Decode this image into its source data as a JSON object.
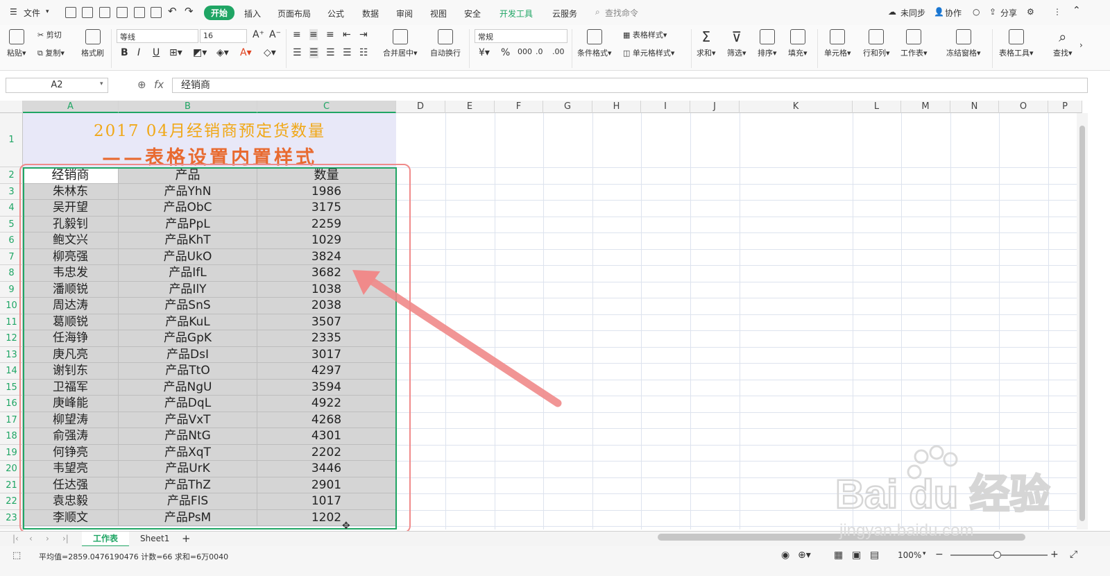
{
  "menubar": {
    "file": "文件",
    "tabs": [
      "开始",
      "插入",
      "页面布局",
      "公式",
      "数据",
      "审阅",
      "视图",
      "安全",
      "开发工具",
      "云服务"
    ],
    "search": "查找命令",
    "sync": "未同步",
    "collab": "协作",
    "share": "分享"
  },
  "ribbon": {
    "paste": "粘贴",
    "cut": "剪切",
    "copy": "复制",
    "format_painter": "格式刷",
    "font_name": "等线",
    "font_size": "16",
    "merge_center": "合并居中",
    "auto_wrap": "自动换行",
    "number_format": "常规",
    "cond_format": "条件格式",
    "table_style": "表格样式",
    "cell_style": "单元格样式",
    "sum": "求和",
    "filter": "筛选",
    "sort": "排序",
    "fill": "填充",
    "cell": "单元格",
    "row_col": "行和列",
    "worksheet": "工作表",
    "freeze": "冻结窗格",
    "table_tools": "表格工具",
    "find": "查找"
  },
  "formula": {
    "name_box": "A2",
    "fx": "fx",
    "value": "经销商"
  },
  "columns": [
    "A",
    "B",
    "C",
    "D",
    "E",
    "F",
    "G",
    "H",
    "I",
    "J",
    "K",
    "L",
    "M",
    "N",
    "O",
    "P"
  ],
  "rows": [
    "1",
    "2",
    "3",
    "4",
    "5",
    "6",
    "7",
    "8",
    "9",
    "10",
    "11",
    "12",
    "13",
    "14",
    "15",
    "16",
    "17",
    "18",
    "19",
    "20",
    "21",
    "22",
    "23"
  ],
  "title": {
    "line1": "2017 04月经销商预定货数量",
    "line2": "——表格设置内置样式"
  },
  "table": {
    "headers": [
      "经销商",
      "产品",
      "数量"
    ],
    "rows": [
      [
        "朱林东",
        "产品YhN",
        "1986"
      ],
      [
        "吴开望",
        "产品ObC",
        "3175"
      ],
      [
        "孔毅钊",
        "产品PpL",
        "2259"
      ],
      [
        "鲍文兴",
        "产品KhT",
        "1029"
      ],
      [
        "柳亮强",
        "产品UkO",
        "3824"
      ],
      [
        "韦忠发",
        "产品IfL",
        "3682"
      ],
      [
        "潘顺锐",
        "产品IlY",
        "1038"
      ],
      [
        "周达涛",
        "产品SnS",
        "2038"
      ],
      [
        "葛顺锐",
        "产品KuL",
        "3507"
      ],
      [
        "任海铮",
        "产品GpK",
        "2335"
      ],
      [
        "庚凡亮",
        "产品DsI",
        "3017"
      ],
      [
        "谢钊东",
        "产品TtO",
        "4297"
      ],
      [
        "卫福军",
        "产品NgU",
        "3594"
      ],
      [
        "庚峰能",
        "产品DqL",
        "4922"
      ],
      [
        "柳望涛",
        "产品VxT",
        "4268"
      ],
      [
        "俞强涛",
        "产品NtG",
        "4301"
      ],
      [
        "何铮亮",
        "产品XqT",
        "2202"
      ],
      [
        "韦望亮",
        "产品UrK",
        "3446"
      ],
      [
        "任达强",
        "产品ThZ",
        "2901"
      ],
      [
        "袁忠毅",
        "产品FlS",
        "1017"
      ],
      [
        "李顺文",
        "产品PsM",
        "1202"
      ]
    ]
  },
  "sheets": [
    "工作表",
    "Sheet1"
  ],
  "status": {
    "summary": "平均值=2859.0476190476  计数=66  求和=6万0040",
    "zoom": "100%"
  },
  "colors": {
    "accent": "#1fa564",
    "annotation": "#f08a8a",
    "title1": "#f0a818",
    "title2": "#e86a30"
  },
  "watermark": {
    "text": "Bai du 经验",
    "sub": "jingyan.baidu.com"
  }
}
